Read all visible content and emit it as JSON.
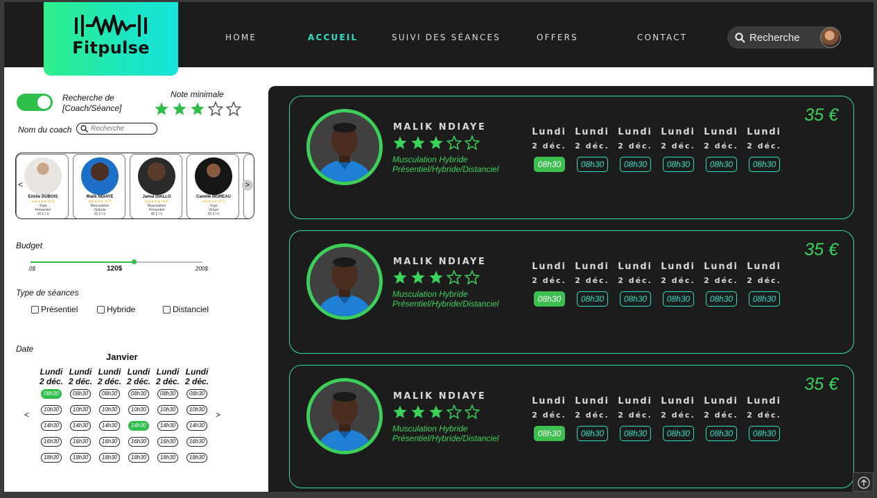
{
  "brand": {
    "name": "Fitpulse"
  },
  "nav": [
    "HOME",
    "ACCUEIL",
    "SUIVI DES SÉANCES",
    "OFFERS",
    "CONTACT"
  ],
  "active_nav": "ACCUEIL",
  "search": {
    "label": "Recherche"
  },
  "filters": {
    "toggle_label": "Recherche de [Coach/Séance]",
    "min_rating_label": "Note minimale",
    "min_rating": 3,
    "coach_name_label": "Nom du coach",
    "coach_search_placeholder": "Recherche",
    "budget_label": "Budget",
    "budget_min": "0$",
    "budget_max": "200$",
    "budget_value": "120$",
    "budget_fraction": 0.6,
    "session_type_label": "Type de séances",
    "session_types": [
      "Présentiel",
      "Hybride",
      "Distanciel"
    ],
    "date_label": "Date",
    "month": "Janvier",
    "days": [
      {
        "day": "Lundi",
        "date": "2 déc."
      },
      {
        "day": "Lundi",
        "date": "2 déc."
      },
      {
        "day": "Lundi",
        "date": "2 déc."
      },
      {
        "day": "Lundi",
        "date": "2 déc."
      },
      {
        "day": "Lundi",
        "date": "2 déc."
      },
      {
        "day": "Lundi",
        "date": "2 déc."
      }
    ],
    "time_slots": [
      "08h30",
      "10h30",
      "14h30",
      "16h30",
      "18h30"
    ],
    "prev_arrow": "<",
    "next_arrow": ">"
  },
  "coach_carousel": [
    {
      "name": "Emilie DUBOIS",
      "rating": "★★★★★ (4,9)",
      "line1": "Yoga",
      "line2": "Présentiel",
      "line3": "30 € / h"
    },
    {
      "name": "Malik NDIAYE",
      "rating": "★★★★★ (4,7)",
      "line1": "Musculation",
      "line2": "Hybride",
      "line3": "25 € / h"
    },
    {
      "name": "Jamal DIALLO",
      "rating": "★★★★★ (4,6)",
      "line1": "Musculation",
      "line2": "Présentiel",
      "line3": "35 € / h"
    },
    {
      "name": "Camille MOREAU",
      "rating": "★★★★★ (4,7)",
      "line1": "Yoga",
      "line2": "Virtuel",
      "line3": "25 € / h"
    }
  ],
  "carousel_prev": "<",
  "carousel_next": ">",
  "results": [
    {
      "name": "MALIK NDIAYE",
      "rating": 3,
      "specialty": "Musculation Hybride",
      "modes": "Présentiel/Hybride/Distanciel",
      "price": "35 €",
      "days": [
        {
          "day": "Lundi",
          "date": "2 déc.",
          "slot": "08h30",
          "selected": true
        },
        {
          "day": "Lundi",
          "date": "2 déc.",
          "slot": "08h30",
          "selected": false
        },
        {
          "day": "Lundi",
          "date": "2 déc.",
          "slot": "08h30",
          "selected": false
        },
        {
          "day": "Lundi",
          "date": "2 déc.",
          "slot": "08h30",
          "selected": false
        },
        {
          "day": "Lundi",
          "date": "2 déc.",
          "slot": "08h30",
          "selected": false
        },
        {
          "day": "Lundi",
          "date": "2 déc.",
          "slot": "08h30",
          "selected": false
        }
      ]
    },
    {
      "name": "MALIK NDIAYE",
      "rating": 3,
      "specialty": "Musculation Hybride",
      "modes": "Présentiel/Hybride/Distanciel",
      "price": "35 €",
      "days": [
        {
          "day": "Lundi",
          "date": "2 déc.",
          "slot": "08h30",
          "selected": true
        },
        {
          "day": "Lundi",
          "date": "2 déc.",
          "slot": "08h30",
          "selected": false
        },
        {
          "day": "Lundi",
          "date": "2 déc.",
          "slot": "08h30",
          "selected": false
        },
        {
          "day": "Lundi",
          "date": "2 déc.",
          "slot": "08h30",
          "selected": false
        },
        {
          "day": "Lundi",
          "date": "2 déc.",
          "slot": "08h30",
          "selected": false
        },
        {
          "day": "Lundi",
          "date": "2 déc.",
          "slot": "08h30",
          "selected": false
        }
      ]
    },
    {
      "name": "MALIK NDIAYE",
      "rating": 3,
      "specialty": "Musculation Hybride",
      "modes": "Présentiel/Hybride/Distanciel",
      "price": "35 €",
      "days": [
        {
          "day": "Lundi",
          "date": "2 déc.",
          "slot": "08h30",
          "selected": true
        },
        {
          "day": "Lundi",
          "date": "2 déc.",
          "slot": "08h30",
          "selected": false
        },
        {
          "day": "Lundi",
          "date": "2 déc.",
          "slot": "08h30",
          "selected": false
        },
        {
          "day": "Lundi",
          "date": "2 déc.",
          "slot": "08h30",
          "selected": false
        },
        {
          "day": "Lundi",
          "date": "2 déc.",
          "slot": "08h30",
          "selected": false
        },
        {
          "day": "Lundi",
          "date": "2 déc.",
          "slot": "08h30",
          "selected": false
        }
      ]
    }
  ],
  "colors": {
    "accent_green": "#3cbf4f",
    "accent_teal": "#2fe0c4",
    "dark_bg": "#1c1c1c"
  },
  "icons": [
    "search-icon",
    "pulse-logo-icon",
    "star-icon",
    "arrow-up-icon"
  ]
}
